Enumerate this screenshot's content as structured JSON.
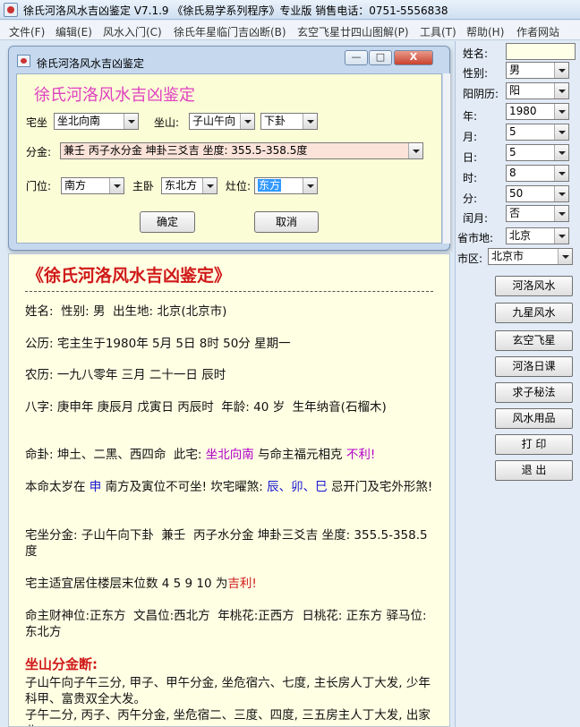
{
  "window": {
    "title": "徐氏河洛风水吉凶鉴定 V7.1.9 《徐氏易学系列程序》专业版 销售电话：0751-5556838"
  },
  "menu": [
    {
      "label": "文件(F)"
    },
    {
      "label": "编辑(E)"
    },
    {
      "label": "风水入门(C)"
    },
    {
      "label": "徐氏年星临门吉凶断(B)"
    },
    {
      "label": "玄空飞星廿四山图解(P)"
    },
    {
      "label": "工具(T)"
    },
    {
      "label": "帮助(H)"
    },
    {
      "label": "作者网站"
    }
  ],
  "dialog": {
    "title": "徐氏河洛风水吉凶鉴定",
    "heading": "徐氏河洛风水吉凶鉴定",
    "minimize": "—",
    "maximize": "□",
    "close": "X",
    "zhaizuo_label": "宅坐",
    "zhaizuo_value": "坐北向南",
    "zuoshan_label": "坐山:",
    "zuoshan_value": "子山午向",
    "gua_value": "下卦",
    "fenjin_label": "分金:",
    "fenjin_value": "兼壬 丙子水分金 坤卦三爻吉 坐度: 355.5-358.5度",
    "menwei_label": "门位:",
    "menwei_value": "南方",
    "zhuwo_label": "主卧",
    "zhuwo_value": "东北方",
    "zaowei_label": "灶位:",
    "zaowei_value": "东方",
    "ok": "确定",
    "cancel": "取消"
  },
  "report": {
    "title": "《徐氏河洛风水吉凶鉴定》",
    "p1": "姓名:  性别: 男  出生地: 北京(北京市)",
    "p2": "公历: 宅主生于1980年 5月 5日 8时 50分 星期一",
    "p3": "农历: 一九八零年 三月 二十一日 辰时",
    "p4": "八字: 庚申年 庚辰月 戊寅日 丙辰时  年龄: 40 岁  生年纳音(石榴木)",
    "p5a": "命卦: 坤土、二黑、西四命  此宅: ",
    "p5b": "坐北向南",
    "p5c": " 与命主福元相克 ",
    "p5d": "不利!",
    "p6a": "本命太岁在 ",
    "p6b": "申",
    "p6c": " 南方及寅位不可坐! 坎宅曜煞: ",
    "p6d": "辰、卯、巳",
    "p6e": " 忌开门及宅外形煞!",
    "p7": "宅坐分金: 子山午向下卦  兼壬  丙子水分金 坤卦三爻吉 坐度: 355.5-358.5度",
    "p8a": "宅主适宜居住楼层末位数 4 5 9 10 为",
    "p8b": "吉利!",
    "p9": "命主财神位:正东方  文昌位:西北方  年桃花:正西方  日桃花: 正东方 驿马位:东北方",
    "h1": "坐山分金断:",
    "p10": "子山午向子午三分, 甲子、甲午分金, 坐危宿六、七度, 主长房人丁大发, 少年科甲、富贵双全大发。",
    "p11": "子午二分, 丙子、丙午分金, 坐危宿二、三度、四度, 三五房主人丁大发, 出家业"
  },
  "panel": {
    "name_label": "姓名:",
    "name_value": "",
    "gender_label": "性别:",
    "gender_value": "男",
    "calendar_label": "阳阴历:",
    "calendar_value": "阳",
    "year_label": "年:",
    "year_value": "1980",
    "month_label": "月:",
    "month_value": "5",
    "day_label": "日:",
    "day_value": "5",
    "hour_label": "时:",
    "hour_value": "8",
    "minute_label": "分:",
    "minute_value": "50",
    "leap_label": "闰月:",
    "leap_value": "否",
    "province_label": "省市地:",
    "province_value": "北京",
    "district_label": "市区:",
    "district_value": "北京市",
    "buttons": [
      "河洛风水",
      "九星风水",
      "玄空飞星",
      "河洛日课",
      "求子秘法",
      "风水用品",
      "打 印",
      "退 出"
    ]
  }
}
